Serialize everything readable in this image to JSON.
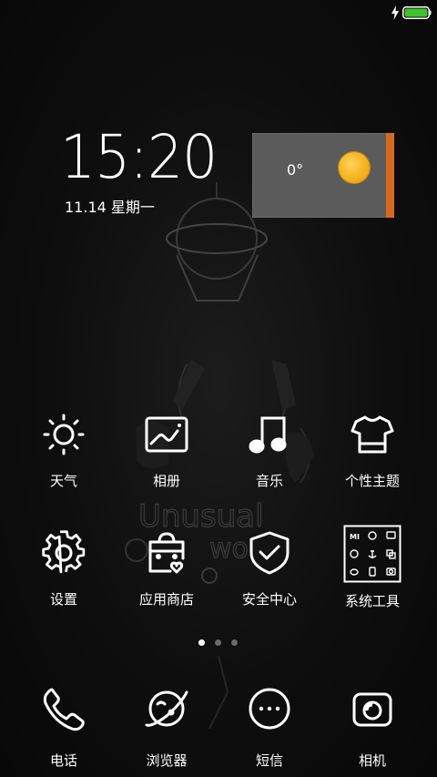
{
  "status_bar": {
    "charging_icon": "lightning-bolt-icon",
    "battery_icon": "battery-full-icon",
    "battery_color": "#3ec22b"
  },
  "clock_widget": {
    "time": "15:20",
    "date": "11.14 星期一"
  },
  "weather_widget": {
    "temperature": "0°",
    "condition_icon": "sun-icon",
    "accent_color": "#d86a1f"
  },
  "apps": [
    {
      "label": "天气",
      "icon": "weather-sun-icon"
    },
    {
      "label": "相册",
      "icon": "gallery-icon"
    },
    {
      "label": "音乐",
      "icon": "music-note-icon"
    },
    {
      "label": "个性主题",
      "icon": "theme-shirt-icon"
    },
    {
      "label": "设置",
      "icon": "settings-gear-icon"
    },
    {
      "label": "应用商店",
      "icon": "app-store-bag-icon"
    },
    {
      "label": "安全中心",
      "icon": "security-shield-icon"
    },
    {
      "label": "系统工具",
      "icon": "system-tools-folder-icon"
    }
  ],
  "page_indicator": {
    "count": 3,
    "active_index": 0
  },
  "dock": [
    {
      "label": "电话",
      "icon": "phone-icon"
    },
    {
      "label": "浏览器",
      "icon": "browser-planet-icon"
    },
    {
      "label": "短信",
      "icon": "message-bubble-icon"
    },
    {
      "label": "相机",
      "icon": "camera-icon"
    }
  ],
  "wallpaper": {
    "text": "Unusual",
    "text2": "wo"
  }
}
